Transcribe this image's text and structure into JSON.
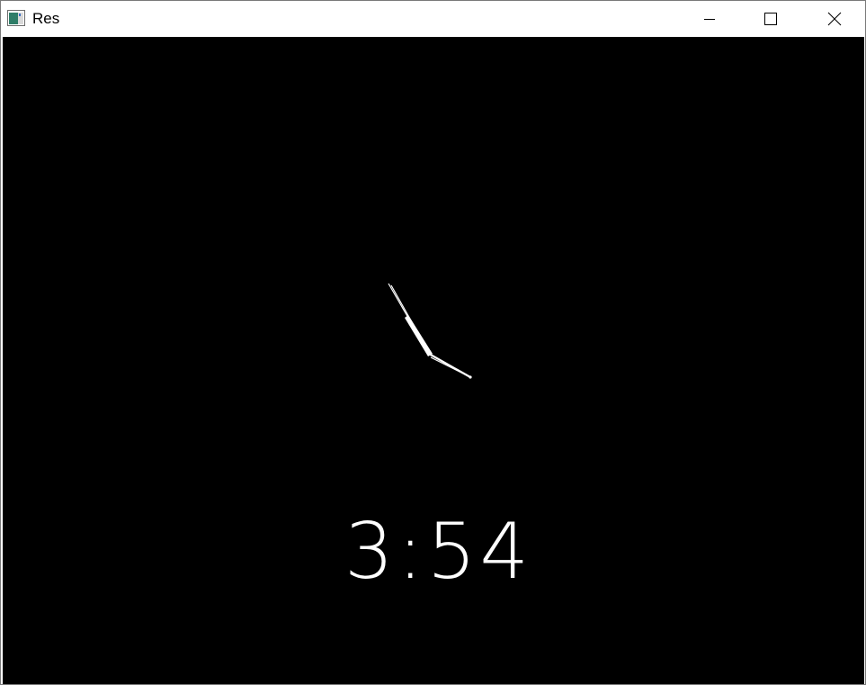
{
  "window": {
    "title": "Res",
    "controls": {
      "minimize": "minimize-icon",
      "maximize": "maximize-icon",
      "close": "close-icon"
    }
  },
  "canvas": {
    "background": "#000000",
    "time_label": "3:54",
    "clock_hands": {
      "hour_hand": {
        "hours": 3,
        "minutes": 54
      },
      "minute_hand": {
        "minutes": 54
      },
      "color": "#ffffff"
    }
  }
}
